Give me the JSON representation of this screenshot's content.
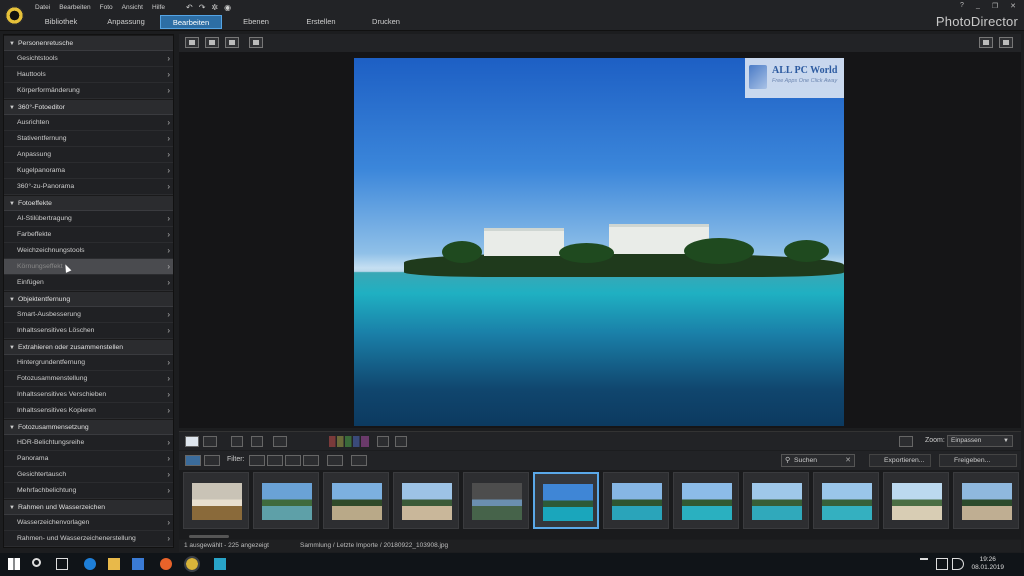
{
  "app": {
    "title": "PhotoDirector",
    "menu": [
      "Datei",
      "Bearbeiten",
      "Foto",
      "Ansicht",
      "Hilfe"
    ],
    "tabs": [
      {
        "label": "Bibliothek",
        "active": false
      },
      {
        "label": "Anpassung",
        "active": false
      },
      {
        "label": "Bearbeiten",
        "active": true
      },
      {
        "label": "Ebenen",
        "active": false
      },
      {
        "label": "Erstellen",
        "active": false
      },
      {
        "label": "Drucken",
        "active": false
      }
    ],
    "window_controls": [
      "?",
      "_",
      "❐",
      "✕"
    ]
  },
  "sidebar": {
    "sections": [
      {
        "title": "Personenretusche",
        "items": [
          "Gesichtstools",
          "Hauttools",
          "Körperformänderung"
        ]
      },
      {
        "title": "360°-Fotoeditor",
        "items": [
          "Ausrichten",
          "Stativentfernung",
          "Anpassung",
          "Kugelpanorama",
          "360°-zu-Panorama"
        ]
      },
      {
        "title": "Fotoeffekte",
        "items": [
          "AI-Stilübertragung",
          "Farbeffekte",
          "Weichzeichnungstools",
          "Körnungseffekt",
          "Einfügen"
        ]
      },
      {
        "title": "Objektentfernung",
        "items": [
          "Smart-Ausbesserung",
          "Inhaltssensitives Löschen"
        ]
      },
      {
        "title": "Extrahieren oder zusammenstellen",
        "items": [
          "Hintergrundentfernung",
          "Fotozusammenstellung",
          "Inhaltssensitives Verschieben",
          "Inhaltssensitives Kopieren"
        ]
      },
      {
        "title": "Fotozusammensetzung",
        "items": [
          "HDR-Belichtungsreihe",
          "Panorama",
          "Gesichtertausch",
          "Mehrfachbelichtung"
        ]
      },
      {
        "title": "Rahmen und Wasserzeichen",
        "items": [
          "Wasserzeichenvorlagen",
          "Rahmen- und Wasserzeichenerstellung"
        ]
      }
    ],
    "hovered_item": "Körnungseffekt"
  },
  "watermark": {
    "title": "ALL PC World",
    "subtitle": "Free Apps One Click Away"
  },
  "toolbar": {
    "filter_label": "Filter:",
    "search_placeholder": "Suchen",
    "export_label": "Exportieren...",
    "share_label": "Freigeben...",
    "zoom_label": "Zoom:",
    "zoom_value": "Einpassen"
  },
  "filmstrip": {
    "selected_index": 5,
    "thumbs": [
      {
        "colors": [
          "#c9c3b6",
          "#e8dfcf",
          "#8a6a3a"
        ]
      },
      {
        "colors": [
          "#6aa2d6",
          "#3f6a3c",
          "#5ea0a8"
        ]
      },
      {
        "colors": [
          "#7cb0e0",
          "#2f4a2a",
          "#b9a988"
        ]
      },
      {
        "colors": [
          "#9dc3e6",
          "#3a5a38",
          "#c9b79a"
        ]
      },
      {
        "colors": [
          "#4d4d4d",
          "#6b8fb0",
          "#46634a"
        ]
      },
      {
        "colors": [
          "#3f86d6",
          "#2d5a38",
          "#1aa6bc"
        ]
      },
      {
        "colors": [
          "#86b6e4",
          "#2f5530",
          "#2aa4ba"
        ]
      },
      {
        "colors": [
          "#8cbce8",
          "#325a32",
          "#2ab0c0"
        ]
      },
      {
        "colors": [
          "#9fc8ea",
          "#385e36",
          "#30a9bb"
        ]
      },
      {
        "colors": [
          "#9ac6ea",
          "#37603a",
          "#34b0c0"
        ]
      },
      {
        "colors": [
          "#bcd9ef",
          "#4a6e44",
          "#d8cdb4"
        ]
      },
      {
        "colors": [
          "#8fb8de",
          "#2b4a2c",
          "#bfae92"
        ]
      }
    ]
  },
  "status": {
    "selection": "1 ausgewählt - 225 angezeigt",
    "path": "Sammlung / Letzte Importe / 20180922_103908.jpg"
  },
  "taskbar": {
    "time": "19:26",
    "date": "08.01.2019"
  }
}
